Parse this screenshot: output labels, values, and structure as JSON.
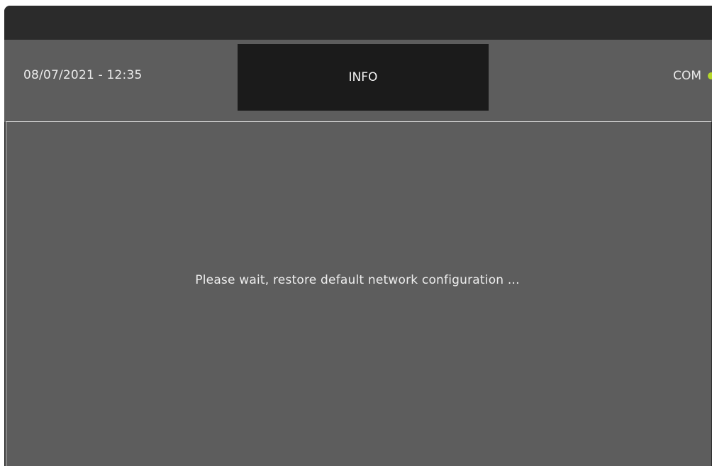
{
  "header": {
    "datetime": "08/07/2021 - 12:35",
    "title": "INFO",
    "com_label": "COM",
    "com_status_color": "#b5d72a"
  },
  "content": {
    "message": "Please wait, restore default network configuration ..."
  },
  "colors": {
    "panel_background": "#5d5d5d",
    "title_background": "#1b1b1b",
    "frame_background": "#2b2b2b"
  }
}
